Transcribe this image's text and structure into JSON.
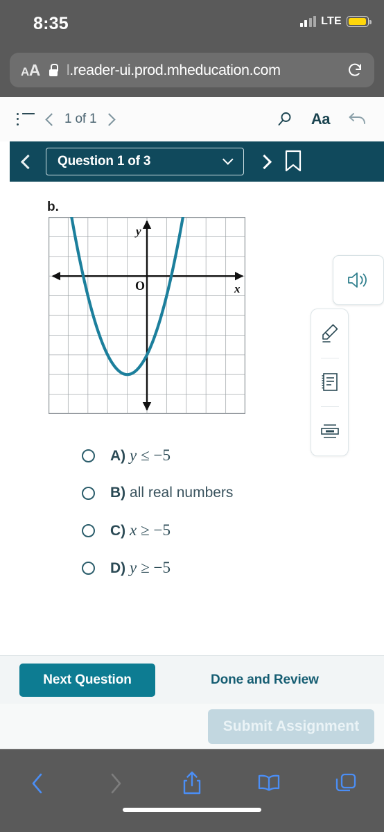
{
  "status_bar": {
    "time": "8:35",
    "carrier_network": "LTE",
    "signal_icon": "cellular-signal-icon",
    "battery_icon": "battery-low-power-icon"
  },
  "browser": {
    "url": ".reader-ui.prod.mheducation.com",
    "url_prefix_dim": "l",
    "text_size_label": "AA",
    "lock_icon": "lock-icon",
    "reload_icon": "reload-icon",
    "bottom_bar": {
      "back_icon": "back-chevron-icon",
      "forward_icon": "forward-chevron-icon",
      "share_icon": "share-icon",
      "bookmarks_icon": "book-icon",
      "tabs_icon": "tabs-icon"
    }
  },
  "reader_toolbar": {
    "contents_icon": "list-contents-icon",
    "prev_icon": "chevron-left-icon",
    "page_count": "1 of 1",
    "next_icon": "chevron-right-icon",
    "search_icon": "search-icon",
    "text_size_label": "Aa",
    "back_icon": "back-arrow-icon"
  },
  "question_bar": {
    "prev_icon": "chevron-left-icon",
    "selector_label": "Question 1 of 3",
    "dropdown_icon": "chevron-down-icon",
    "next_icon": "chevron-right-icon",
    "bookmark_icon": "bookmark-icon"
  },
  "floating_tools": {
    "audio_icon": "speaker-audio-icon",
    "palette": [
      {
        "icon": "highlighter-pen-icon"
      },
      {
        "icon": "notes-icon"
      },
      {
        "icon": "text-strip-icon"
      }
    ]
  },
  "question": {
    "part_label": "b.",
    "choices": [
      {
        "letter": "A)",
        "variable": "y",
        "operator": "≤",
        "value": "−5",
        "plain": ""
      },
      {
        "letter": "B)",
        "variable": "",
        "operator": "",
        "value": "",
        "plain": "all real numbers"
      },
      {
        "letter": "C)",
        "variable": "x",
        "operator": "≥",
        "value": "−5",
        "plain": ""
      },
      {
        "letter": "D)",
        "variable": "y",
        "operator": "≥",
        "value": "−5",
        "plain": ""
      }
    ],
    "selected": null
  },
  "chart_data": {
    "type": "line",
    "title": "",
    "xlabel": "x",
    "ylabel": "y",
    "origin_label": "O",
    "grid": true,
    "xlim": [
      -5,
      5
    ],
    "ylim": [
      -7,
      3
    ],
    "grid_cols": 10,
    "grid_rows": 10,
    "curve_color": "#1c7f9c",
    "axis_color": "#111111",
    "grid_color": "#9aa0a4",
    "series": [
      {
        "name": "parabola",
        "equation": "y = (x + 1)^2 - 5",
        "vertex": [
          -1,
          -5
        ],
        "opens": "up",
        "x": [
          -4.0,
          -3.5,
          -3.0,
          -2.5,
          -2.0,
          -1.5,
          -1.0,
          -0.5,
          0.0,
          0.5,
          1.0,
          1.5,
          2.0
        ],
        "y": [
          4.0,
          1.25,
          -1.0,
          -2.75,
          -4.0,
          -4.75,
          -5.0,
          -4.75,
          -4.0,
          -2.75,
          -1.0,
          1.25,
          4.0
        ]
      }
    ]
  },
  "footer": {
    "next_question_label": "Next Question",
    "done_review_label": "Done and Review",
    "submit_label": "Submit Assignment",
    "submit_disabled": true
  },
  "colors": {
    "teal_dark": "#10495c",
    "teal_button": "#0d7c92",
    "curve": "#1c7f9c",
    "ios_blue": "#4b8ef5"
  }
}
